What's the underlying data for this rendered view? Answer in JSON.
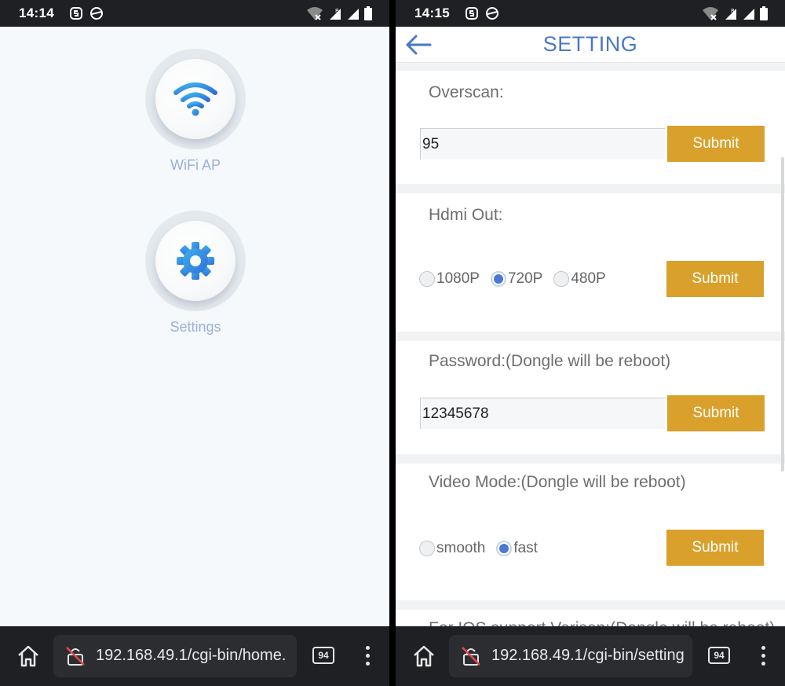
{
  "left": {
    "status": {
      "time": "14:14"
    },
    "home": {
      "wifi_label": "WiFi AP",
      "settings_label": "Settings"
    },
    "browser": {
      "url": "192.168.49.1/cgi-bin/home.",
      "tab_count": "94"
    }
  },
  "right": {
    "status": {
      "time": "14:15"
    },
    "header": {
      "title": "SETTING"
    },
    "overscan": {
      "label": "Overscan:",
      "value": "95",
      "submit": "Submit"
    },
    "hdmi": {
      "label": "Hdmi Out:",
      "options": [
        "1080P",
        "720P",
        "480P"
      ],
      "selected": "720P",
      "submit": "Submit"
    },
    "password": {
      "label": "Password:(Dongle will be reboot)",
      "value": "12345678",
      "submit": "Submit"
    },
    "video_mode": {
      "label": "Video Mode:(Dongle will be reboot)",
      "options": [
        "smooth",
        "fast"
      ],
      "selected": "fast",
      "submit": "Submit"
    },
    "ios": {
      "label": "For IOS support Verison:(Dongle will be reboot)"
    },
    "browser": {
      "url": "192.168.49.1/cgi-bin/setting",
      "tab_count": "94"
    }
  },
  "colors": {
    "accent_blue": "#4a78c7",
    "submit_gold": "#d9a12b",
    "label_muted": "#9bb0d4",
    "bar_dark": "#1f2023"
  }
}
